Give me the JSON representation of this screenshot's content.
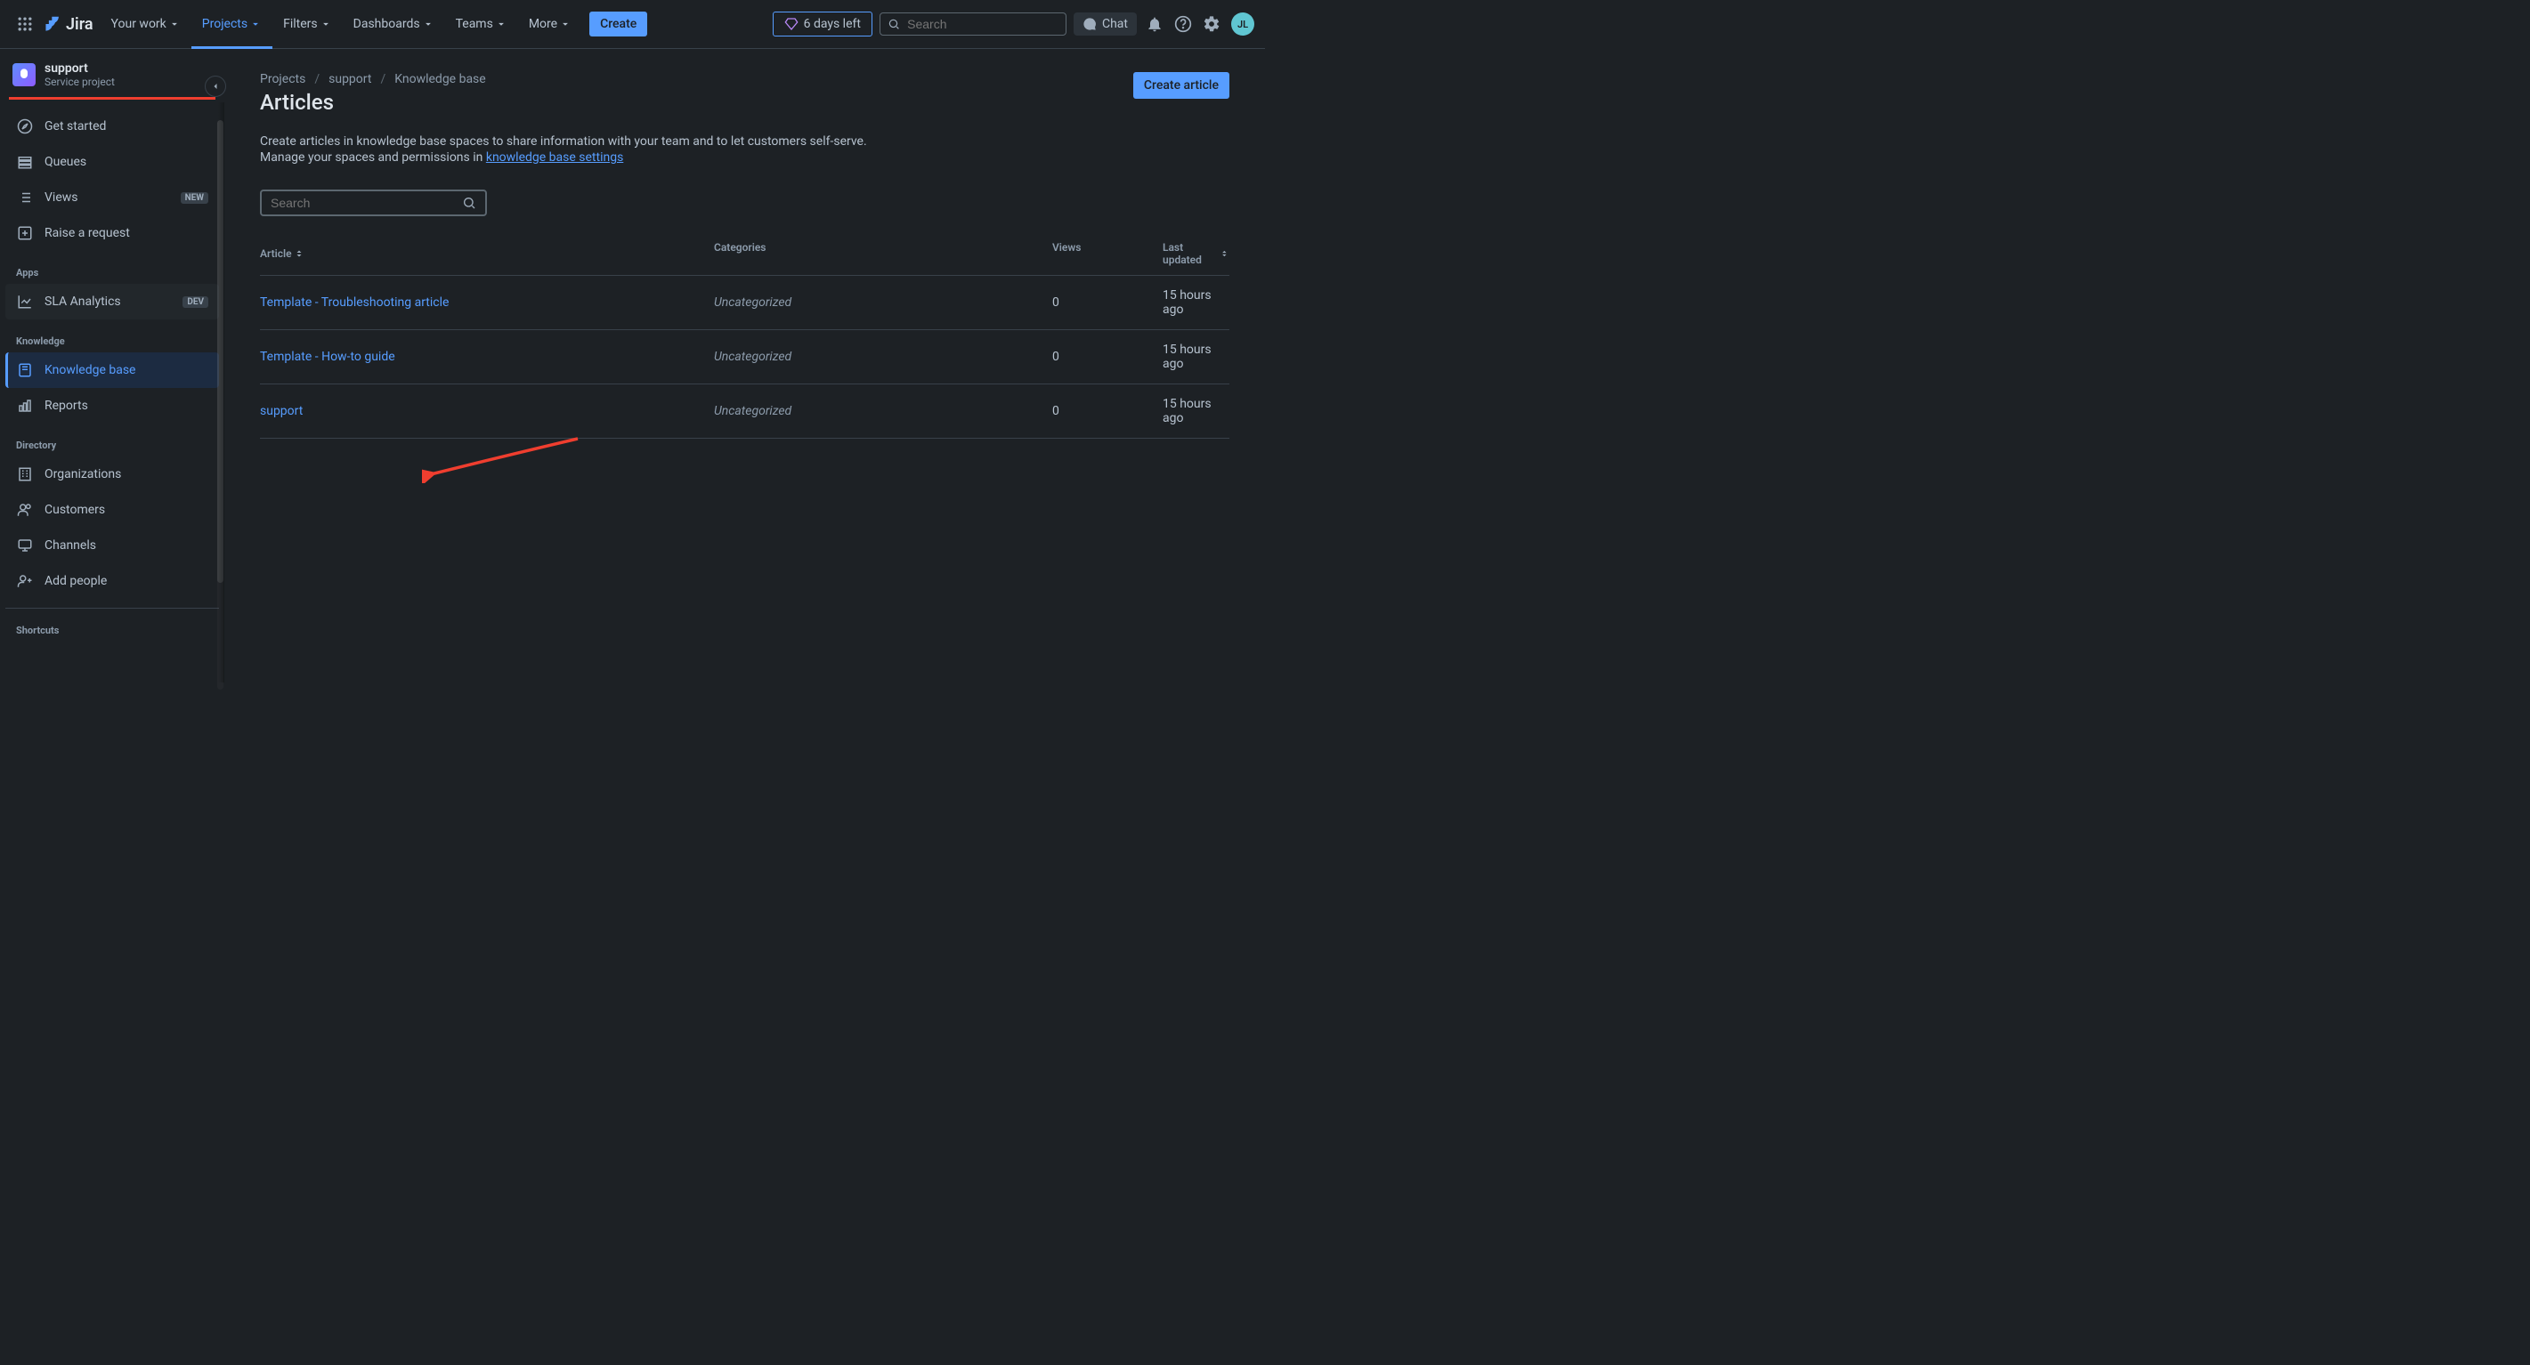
{
  "topbar": {
    "logo": "Jira",
    "your_work": "Your work",
    "projects": "Projects",
    "filters": "Filters",
    "dashboards": "Dashboards",
    "teams": "Teams",
    "more": "More",
    "create": "Create",
    "trial": "6 days left",
    "search_placeholder": "Search",
    "chat": "Chat",
    "avatar_initials": "JL"
  },
  "sidebar": {
    "project_name": "support",
    "project_type": "Service project",
    "get_started": "Get started",
    "queues": "Queues",
    "views": "Views",
    "views_badge": "NEW",
    "raise_request": "Raise a request",
    "apps_label": "Apps",
    "sla_analytics": "SLA Analytics",
    "sla_badge": "DEV",
    "knowledge_label": "Knowledge",
    "knowledge_base": "Knowledge base",
    "reports": "Reports",
    "directory_label": "Directory",
    "organizations": "Organizations",
    "customers": "Customers",
    "channels": "Channels",
    "add_people": "Add people",
    "shortcuts_label": "Shortcuts"
  },
  "main": {
    "crumb_projects": "Projects",
    "crumb_support": "support",
    "crumb_kb": "Knowledge base",
    "title": "Articles",
    "create_article": "Create article",
    "desc_line1": "Create articles in knowledge base spaces to share information with your team and to let customers self-serve.",
    "desc_line2_prefix": "Manage your spaces and permissions in ",
    "desc_link": "knowledge base settings",
    "search_placeholder": "Search",
    "col_article": "Article",
    "col_categories": "Categories",
    "col_views": "Views",
    "col_updated": "Last updated",
    "rows": [
      {
        "article": "Template - Troubleshooting article",
        "category": "Uncategorized",
        "views": "0",
        "updated": "15 hours ago"
      },
      {
        "article": "Template - How-to guide",
        "category": "Uncategorized",
        "views": "0",
        "updated": "15 hours ago"
      },
      {
        "article": "support",
        "category": "Uncategorized",
        "views": "0",
        "updated": "15 hours ago"
      }
    ]
  }
}
